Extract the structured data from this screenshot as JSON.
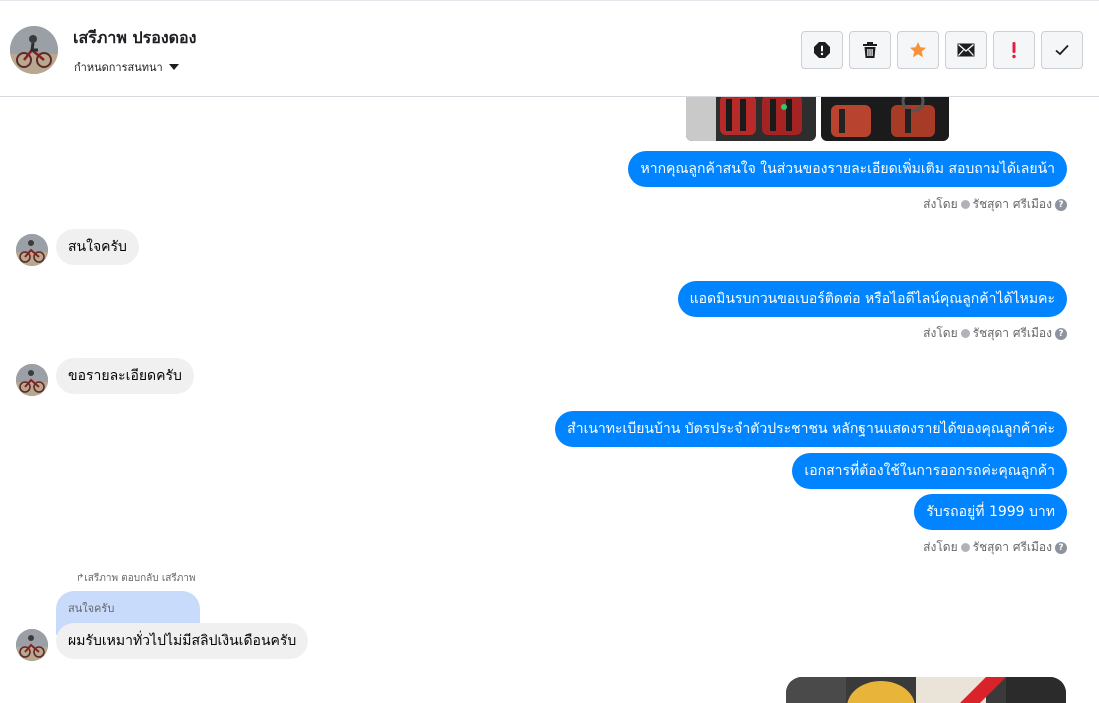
{
  "header": {
    "contact_name": "เสรีภาพ ปรองดอง",
    "assign_label": "กำหนดการสนทนา"
  },
  "actions": [
    {
      "icon": "exclamation-circle-icon"
    },
    {
      "icon": "trash-icon"
    },
    {
      "icon": "star-icon",
      "color": "#f7923b"
    },
    {
      "icon": "envelope-icon"
    },
    {
      "icon": "exclamation-icon",
      "color": "#e41e3f"
    },
    {
      "icon": "checkmark-icon"
    }
  ],
  "messages": {
    "m1": "หากคุณลูกค้าสนใจ ในส่วนของรายละเอียดเพิ่มเติม สอบถามได้เลยน้า",
    "m2": "สนใจครับ",
    "m3": "แอดมินรบกวนขอเบอร์ติดต่อ หรือไอดีไลน์คุณลูกค้าได้ไหมคะ",
    "m4": "ขอรายละเอียดครับ",
    "m5": "สำเนาทะเบียนบ้าน บัตรประจำตัวประชาชน หลักฐานแสดงรายได้ของคุณลูกค้าค่ะ",
    "m6": "เอกสารที่ต้องใช้ในการออกรถค่ะคุณลูกค้า",
    "m7": "รับรถอยู่ที่ 1999 บาท",
    "m8": "ผมรับเหมาทั่วไปไม่มีสลิปเงินเดือนครับ"
  },
  "sent_by": {
    "prefix": "ส่งโดย",
    "agent": "รัชสุดา ศรีเมือง"
  },
  "reply": {
    "label": "เสรีภาพ ตอบกลับ เสรีภาพ",
    "quoted_text": "สนใจครับ"
  },
  "colors": {
    "outgoing": "#0084ff",
    "incoming": "#f0f0f0",
    "quoted": "#c9dbfb"
  }
}
